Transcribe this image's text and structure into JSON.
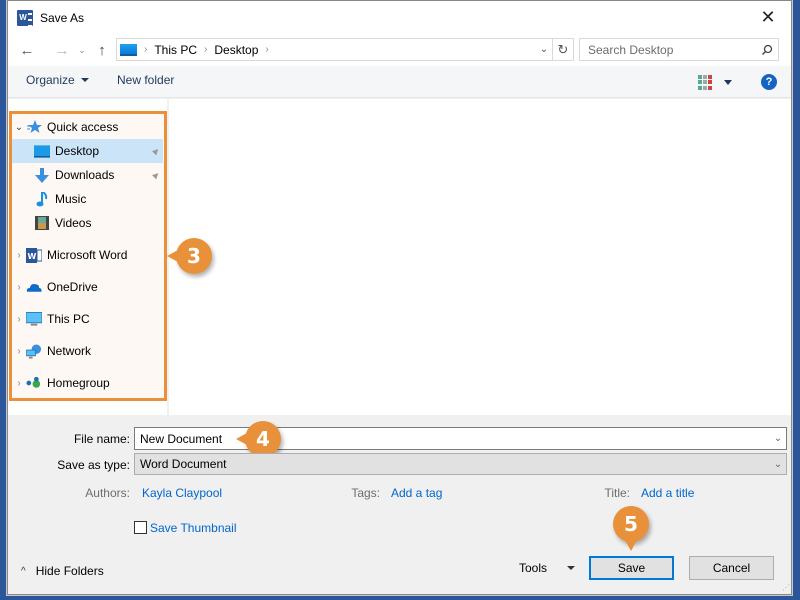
{
  "window": {
    "title": "Save As",
    "close_glyph": "✕"
  },
  "navigation": {
    "back_glyph": "←",
    "forward_glyph": "→",
    "recent_glyph": "⌄",
    "up_glyph": "↑",
    "breadcrumbs": [
      "This PC",
      "Desktop"
    ],
    "separator": "›",
    "dropdown_glyph": "⌄",
    "refresh_glyph": "↻"
  },
  "search": {
    "placeholder": "Search Desktop"
  },
  "toolbar": {
    "organize_label": "Organize",
    "new_folder_label": "New folder",
    "help_glyph": "?"
  },
  "nav_pane": {
    "items": [
      {
        "label": "Quick access",
        "icon": "star-icon",
        "expanded": true,
        "level": 0
      },
      {
        "label": "Desktop",
        "icon": "desktop-icon",
        "pinned": true,
        "selected": true,
        "level": 1
      },
      {
        "label": "Downloads",
        "icon": "download-icon",
        "pinned": true,
        "level": 1
      },
      {
        "label": "Music",
        "icon": "music-icon",
        "level": 1
      },
      {
        "label": "Videos",
        "icon": "video-icon",
        "level": 1
      },
      {
        "label": "Microsoft Word",
        "icon": "word-icon",
        "level": 0
      },
      {
        "label": "OneDrive",
        "icon": "onedrive-icon",
        "level": 0
      },
      {
        "label": "This PC",
        "icon": "computer-icon",
        "level": 0
      },
      {
        "label": "Network",
        "icon": "network-icon",
        "level": 0
      },
      {
        "label": "Homegroup",
        "icon": "homegroup-icon",
        "level": 0
      }
    ],
    "chevron_collapsed": "›",
    "chevron_expanded": "⌄",
    "pin_glyph": "📌"
  },
  "form": {
    "file_name_label": "File name:",
    "file_name_value": "New Document",
    "save_as_type_label": "Save as type:",
    "save_as_type_value": "Word Document",
    "authors_label": "Authors:",
    "authors_value": "Kayla Claypool",
    "tags_label": "Tags:",
    "tags_value": "Add a tag",
    "title_label": "Title:",
    "title_value": "Add a title",
    "thumbnail_label": "Save Thumbnail",
    "thumbnail_checked": false
  },
  "footer": {
    "hide_folders_label": "Hide Folders",
    "tools_label": "Tools",
    "save_label": "Save",
    "cancel_label": "Cancel"
  },
  "callouts": {
    "nav_pane": "3",
    "file_name": "4",
    "save": "5"
  },
  "colors": {
    "accent_callout": "#e8913a",
    "link": "#0066cc",
    "selection": "#cce4f7",
    "default_button_border": "#0078d7",
    "background_app": "#2b579a"
  }
}
